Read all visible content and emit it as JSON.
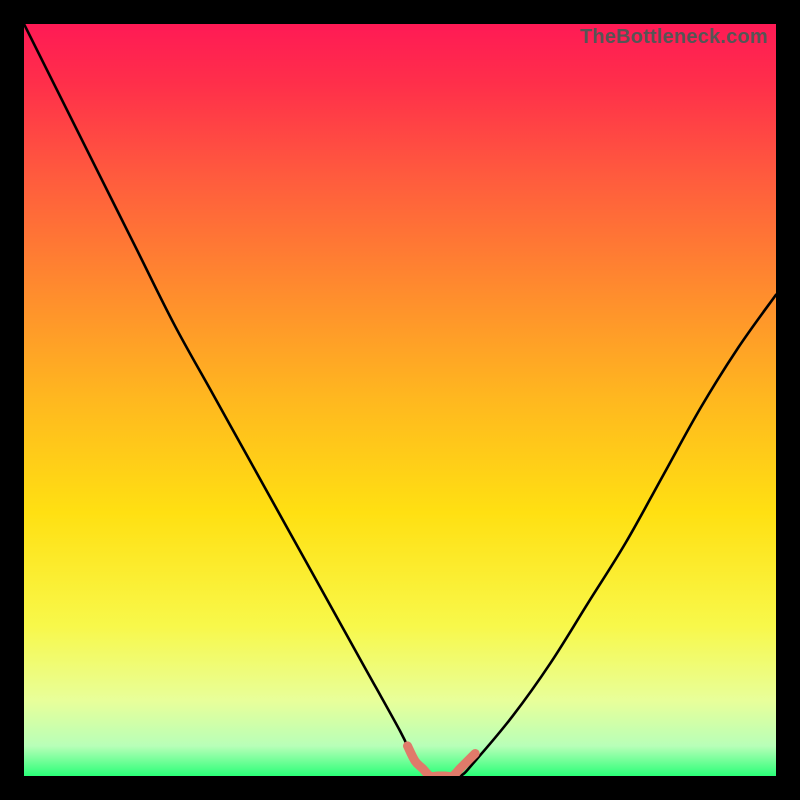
{
  "watermark": {
    "text": "TheBottleneck.com"
  },
  "chart_data": {
    "type": "line",
    "title": "",
    "xlabel": "",
    "ylabel": "",
    "xlim": [
      0,
      100
    ],
    "ylim": [
      0,
      100
    ],
    "series": [
      {
        "name": "bottleneck-curve",
        "x": [
          0,
          5,
          10,
          15,
          20,
          25,
          30,
          35,
          40,
          45,
          50,
          52,
          54,
          56,
          58,
          60,
          65,
          70,
          75,
          80,
          85,
          90,
          95,
          100
        ],
        "y": [
          100,
          90,
          80,
          70,
          60,
          51,
          42,
          33,
          24,
          15,
          6,
          2,
          0,
          0,
          0,
          2,
          8,
          15,
          23,
          31,
          40,
          49,
          57,
          64
        ]
      },
      {
        "name": "sweet-spot",
        "x": [
          51,
          52,
          53,
          54,
          55,
          56,
          57,
          58,
          59,
          60
        ],
        "y": [
          4,
          2,
          1,
          0,
          0,
          0,
          0,
          1,
          2,
          3
        ]
      }
    ],
    "colors": {
      "curve": "#000000",
      "sweet_spot": "#e07a6a"
    }
  }
}
